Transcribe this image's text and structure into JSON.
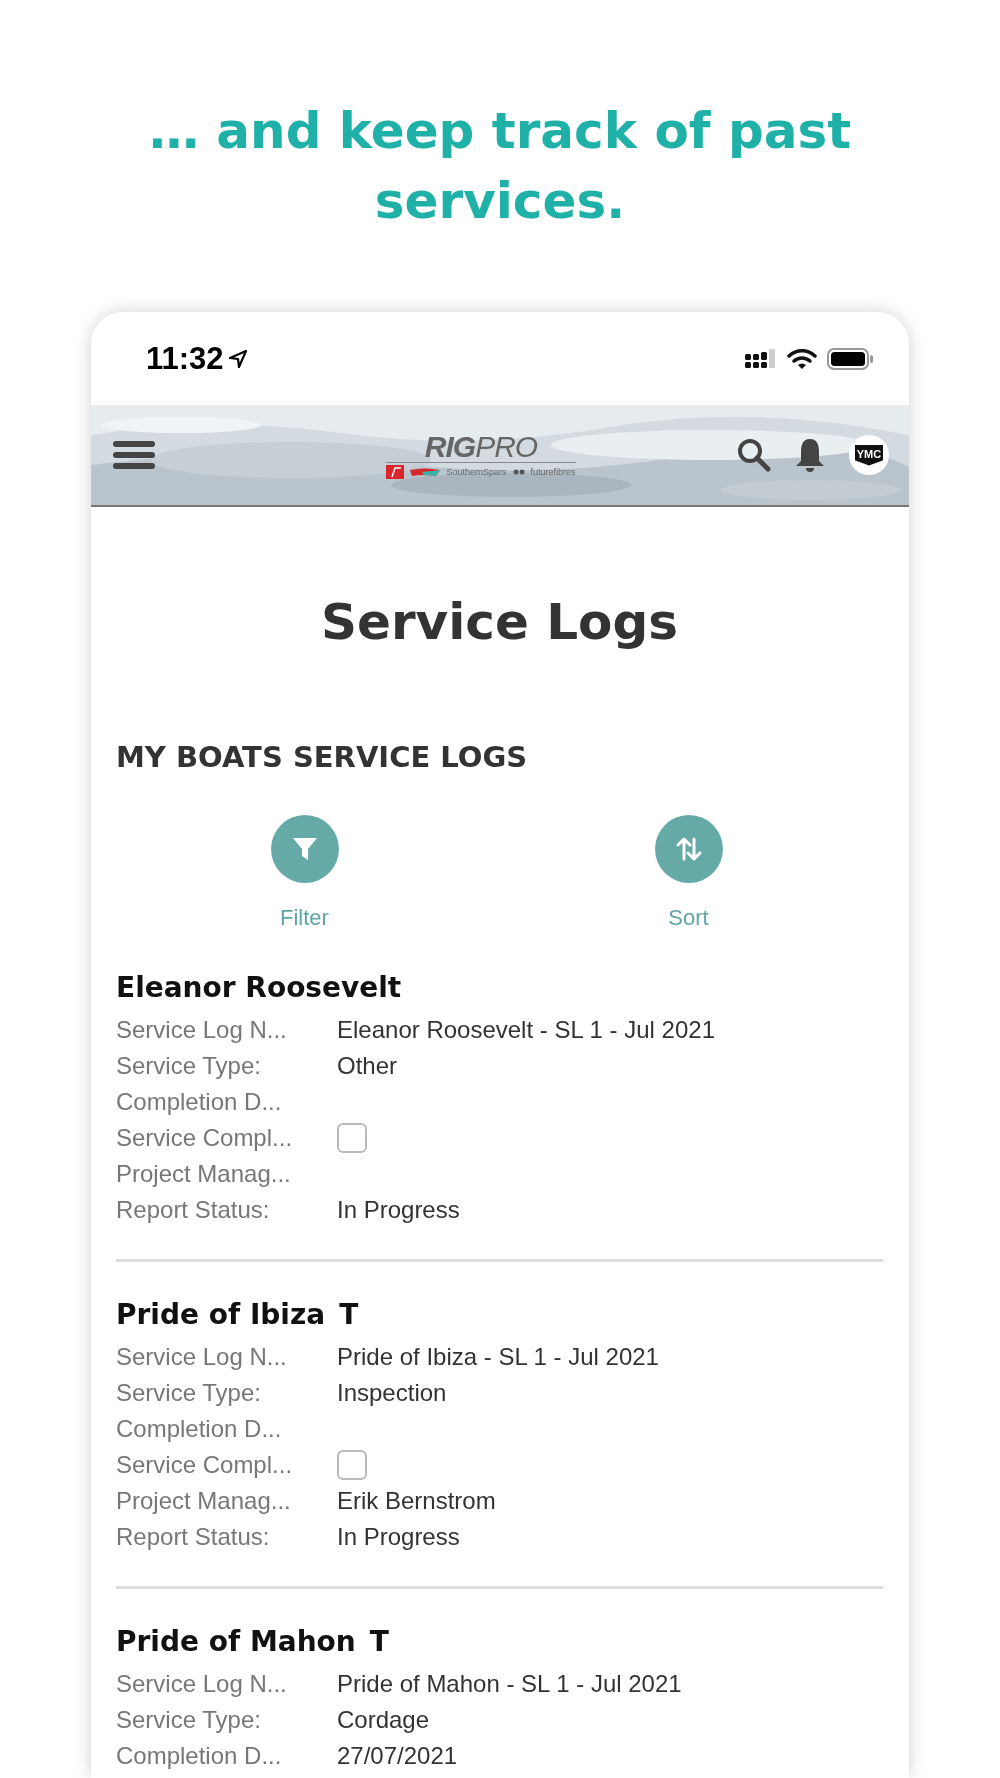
{
  "headline": "… and keep track of past services.",
  "status_bar": {
    "time": "11:32"
  },
  "header": {
    "logo": {
      "bold": "RIG",
      "light": "PRO",
      "sub": [
        "SouthernSpars",
        "futurefibres"
      ]
    },
    "avatar": "YMC"
  },
  "page_title": "Service Logs",
  "section_title": "MY BOATS SERVICE LOGS",
  "actions": [
    {
      "kind": "filter",
      "label": "Filter"
    },
    {
      "kind": "sort",
      "label": "Sort"
    }
  ],
  "boats": [
    {
      "name": "Eleanor Roosevelt",
      "fields": [
        {
          "kind": "text",
          "label": "Service Log N...",
          "value": "Eleanor Roosevelt - SL 1 - Jul 2021"
        },
        {
          "kind": "text",
          "label": "Service Type:",
          "value": "Other"
        },
        {
          "kind": "text",
          "label": "Completion D..."
        },
        {
          "kind": "checkbox",
          "label": "Service Compl...",
          "checked": false
        },
        {
          "kind": "text",
          "label": "Project Manag..."
        },
        {
          "kind": "text",
          "label": "Report Status:",
          "value": "In Progress"
        }
      ]
    },
    {
      "name": "Pride of Ibiza",
      "tag": "T",
      "fields": [
        {
          "kind": "text",
          "label": "Service Log N...",
          "value": "Pride of Ibiza - SL 1 - Jul 2021"
        },
        {
          "kind": "text",
          "label": "Service Type:",
          "value": "Inspection"
        },
        {
          "kind": "text",
          "label": "Completion D..."
        },
        {
          "kind": "checkbox",
          "label": "Service Compl...",
          "checked": false
        },
        {
          "kind": "text",
          "label": "Project Manag...",
          "value": "Erik Bernstrom"
        },
        {
          "kind": "text",
          "label": "Report Status:",
          "value": "In Progress"
        }
      ]
    },
    {
      "name": "Pride of Mahon",
      "tag": "T",
      "fields": [
        {
          "kind": "text",
          "label": "Service Log N...",
          "value": "Pride of Mahon - SL 1 - Jul 2021"
        },
        {
          "kind": "text",
          "label": "Service Type:",
          "value": "Cordage"
        },
        {
          "kind": "text",
          "label": "Completion D...",
          "value": "27/07/2021"
        }
      ]
    }
  ]
}
